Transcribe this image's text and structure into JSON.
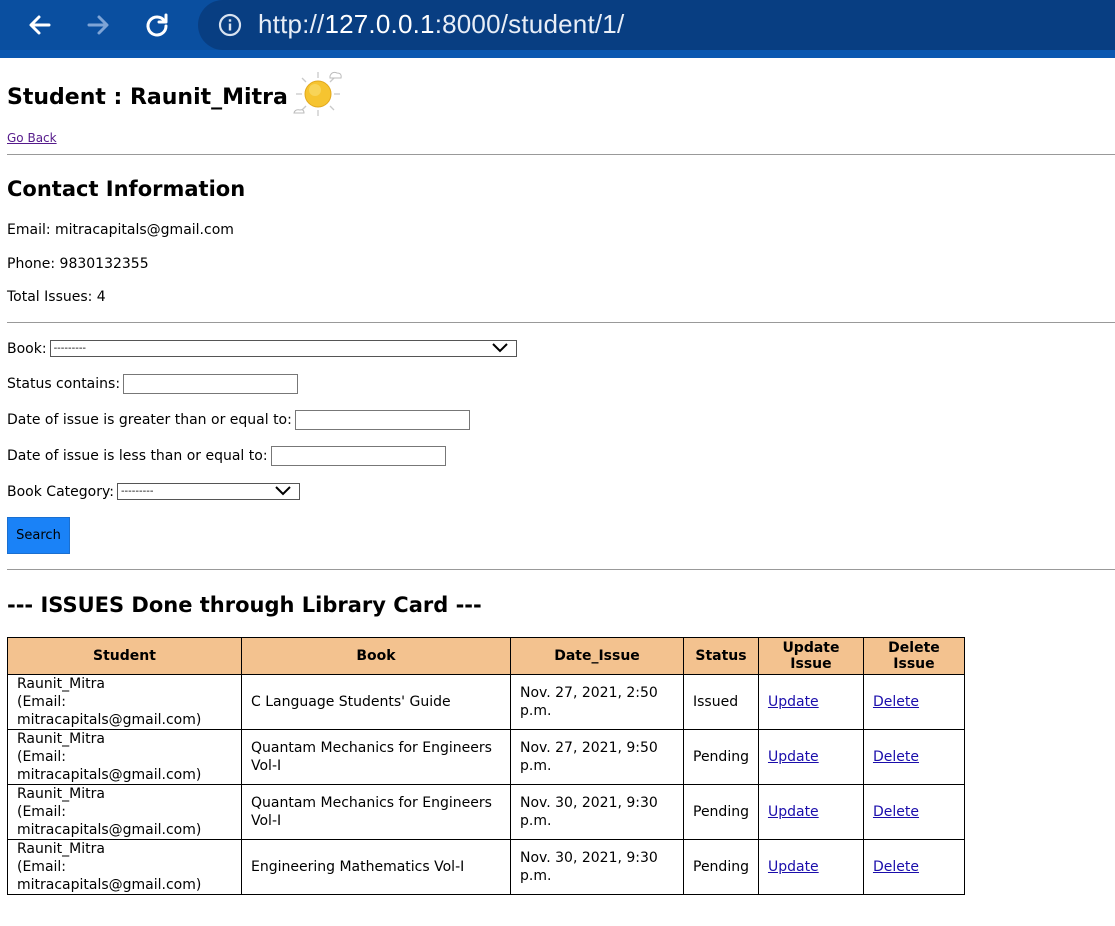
{
  "browser": {
    "url_prefix": "http://",
    "url_host": "127.0.0.1",
    "url_rest": ":8000/student/1/"
  },
  "page": {
    "title": "Student : Raunit_Mitra",
    "go_back": "Go Back"
  },
  "contact": {
    "heading": "Contact Information",
    "email": "Email: mitracapitals@gmail.com",
    "phone": "Phone: 9830132355",
    "total_issues": "Total Issues: 4"
  },
  "filter": {
    "book_label": "Book:",
    "book_value": "---------",
    "status_label": "Status contains:",
    "status_value": "",
    "date_gte_label": "Date of issue is greater than or equal to:",
    "date_gte_value": "",
    "date_lte_label": "Date of issue is less than or equal to:",
    "date_lte_value": "",
    "category_label": "Book Category:",
    "category_value": "---------",
    "search_label": "Search"
  },
  "issues": {
    "heading": "--- ISSUES Done through Library Card ---",
    "columns": [
      "Student",
      "Book",
      "Date_Issue",
      "Status",
      "Update Issue",
      "Delete Issue"
    ],
    "rows": [
      {
        "student": "Raunit_Mitra",
        "email": "(Email: mitracapitals@gmail.com)",
        "book": "C Language Students' Guide",
        "date": "Nov. 27, 2021, 2:50 p.m.",
        "status": "Issued",
        "update": "Update",
        "delete": "Delete"
      },
      {
        "student": "Raunit_Mitra",
        "email": "(Email: mitracapitals@gmail.com)",
        "book": "Quantam Mechanics for Engineers Vol-I",
        "date": "Nov. 27, 2021, 9:50 p.m.",
        "status": "Pending",
        "update": "Update",
        "delete": "Delete"
      },
      {
        "student": "Raunit_Mitra",
        "email": "(Email: mitracapitals@gmail.com)",
        "book": "Quantam Mechanics for Engineers Vol-I",
        "date": "Nov. 30, 2021, 9:30 p.m.",
        "status": "Pending",
        "update": "Update",
        "delete": "Delete"
      },
      {
        "student": "Raunit_Mitra",
        "email": "(Email: mitracapitals@gmail.com)",
        "book": "Engineering Mathematics Vol-I",
        "date": "Nov. 30, 2021, 9:30 p.m.",
        "status": "Pending",
        "update": "Update",
        "delete": "Delete"
      }
    ]
  },
  "colors": {
    "browser_bar": "#0a4fa0",
    "table_header": "#f3c28f",
    "search_button": "#1a82f7"
  },
  "icons": [
    "back-arrow-icon",
    "forward-arrow-icon",
    "reload-icon",
    "info-icon",
    "sun-icon",
    "chevron-down-icon"
  ]
}
